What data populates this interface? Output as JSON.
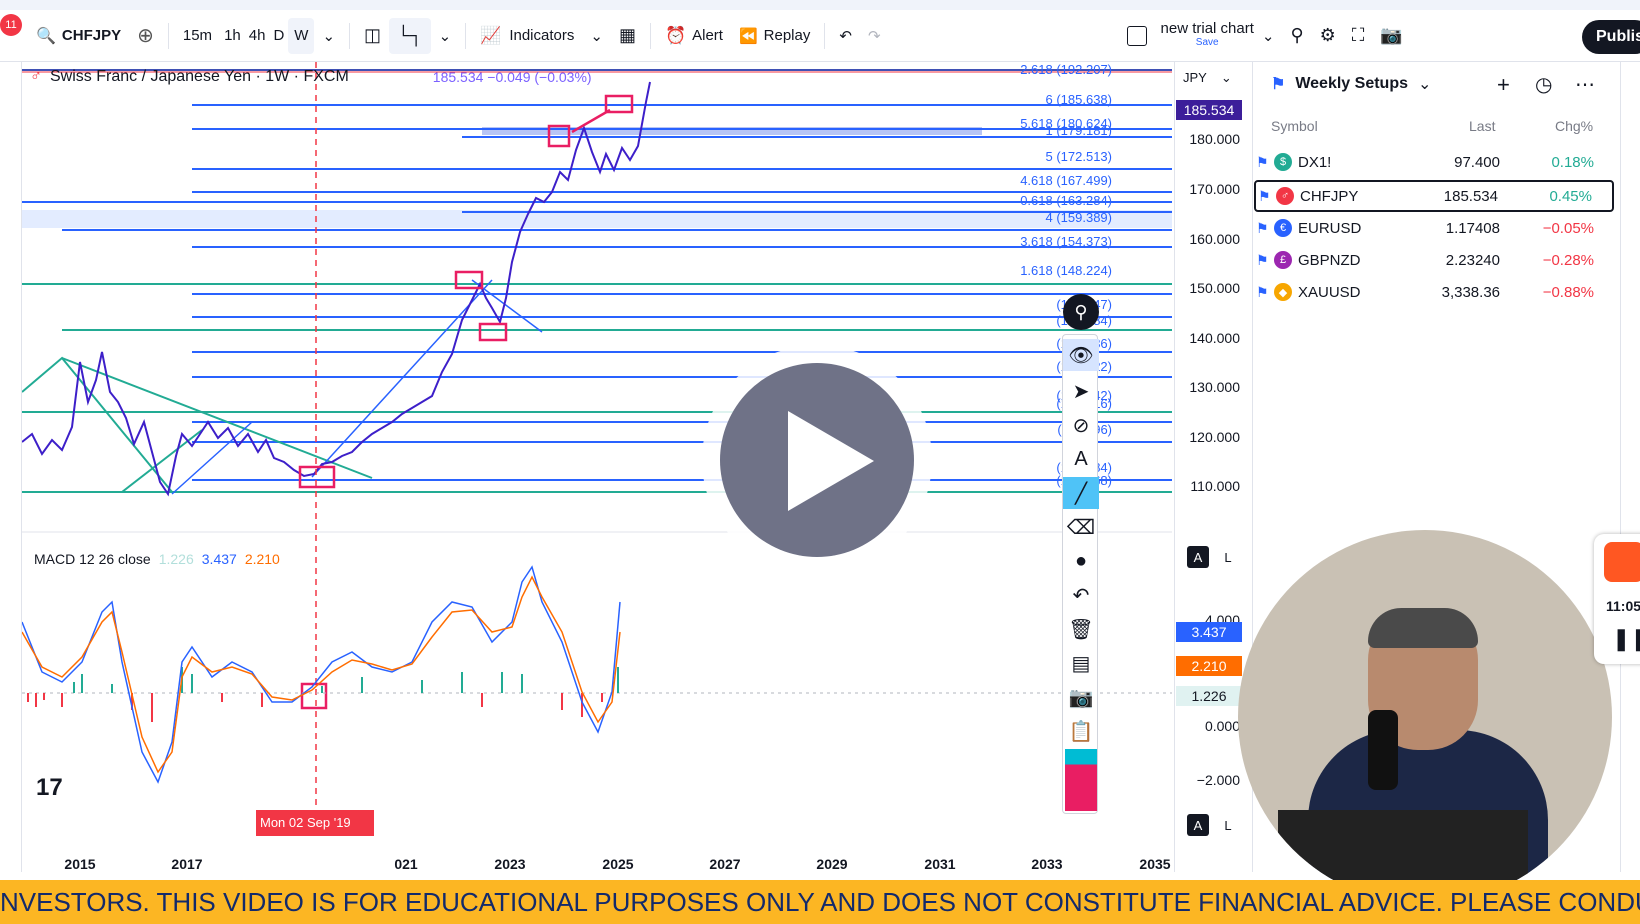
{
  "toolbar": {
    "badge": "11",
    "symbol": "CHFJPY",
    "intervals": [
      "15m",
      "1h",
      "4h",
      "D",
      "W"
    ],
    "indicators": "Indicators",
    "alert": "Alert",
    "replay": "Replay",
    "layout_name": "new trial chart",
    "layout_sub": "Save",
    "publish": "Publis"
  },
  "legend": {
    "title": "Swiss Franc / Japanese Yen · 1W · FXCM",
    "values": "185.534 −0.049 (−0.03%)"
  },
  "price_axis": {
    "currency": "JPY",
    "ticks": [
      "180.000",
      "170.000",
      "160.000",
      "150.000",
      "140.000",
      "130.000",
      "120.000",
      "110.000"
    ],
    "last_price": "185.534",
    "macd_ticks": [
      "4.000",
      "0.000",
      "−2.000"
    ],
    "macd_tags": [
      {
        "text": "3.437",
        "color": "#2962ff"
      },
      {
        "text": "2.210",
        "color": "#ff6d00"
      },
      {
        "text": "1.226",
        "color": "#e0f2f1"
      }
    ],
    "auto": "A",
    "log": "L"
  },
  "fib_levels": [
    "2.618 (192.207)",
    "6 (185.638)",
    "5.618 (180.624)",
    "1 (179.181)",
    "5 (172.513)",
    "4.618 (167.499)",
    "0.618 (163.284)",
    "4 (159.389)",
    "3.618 (154.373)",
    "1.618 (148.224)",
    "(141.247)",
    "(137.584)",
    "(133.136)",
    "(128.122)",
    "(121.842)",
    "(120.016)",
    "(114.996)",
    "(106.884)",
    "(105.868)"
  ],
  "macd": {
    "label": "MACD 12 26 close",
    "v1": "1.226",
    "v2": "3.437",
    "v3": "2.210"
  },
  "x_axis": {
    "labels": [
      "2015",
      "2017",
      "2023",
      "2025",
      "2027",
      "2029",
      "2031",
      "2033",
      "2035"
    ],
    "crosshair_date": "Mon 02 Sep '19",
    "partial_label": "021"
  },
  "watchlist": {
    "title": "Weekly Setups",
    "columns": [
      "Symbol",
      "Last",
      "Chg%"
    ],
    "rows": [
      {
        "symbol": "DX1!",
        "last": "97.400",
        "chg": "0.18%",
        "icon": "$",
        "icon_color": "#22ab94",
        "positive": true
      },
      {
        "symbol": "CHFJPY",
        "last": "185.534",
        "chg": "0.45%",
        "icon": "♂",
        "icon_color": "#f23645",
        "positive": true
      },
      {
        "symbol": "EURUSD",
        "last": "1.17408",
        "chg": "−0.05%",
        "icon": "€",
        "icon_color": "#2962ff",
        "positive": false
      },
      {
        "symbol": "GBPNZD",
        "last": "2.23240",
        "chg": "−0.28%",
        "icon": "£",
        "icon_color": "#9c27b0",
        "positive": false
      },
      {
        "symbol": "XAUUSD",
        "last": "3,338.36",
        "chg": "−0.88%",
        "icon": "◆",
        "icon_color": "#f7a600",
        "positive": false
      }
    ]
  },
  "recorder": {
    "time": "11:05"
  },
  "ticker_text": "NVESTORS. THIS VIDEO IS FOR EDUCATIONAL PURPOSES ONLY AND DOES NOT CONSTITUTE FINANCIAL ADVICE. PLEASE CONDUCT Y",
  "colors": {
    "accent": "#2962ff",
    "fib_line": "#2962ff",
    "highlight_box": "#e91e63",
    "ticker_bg": "#fcb623"
  }
}
